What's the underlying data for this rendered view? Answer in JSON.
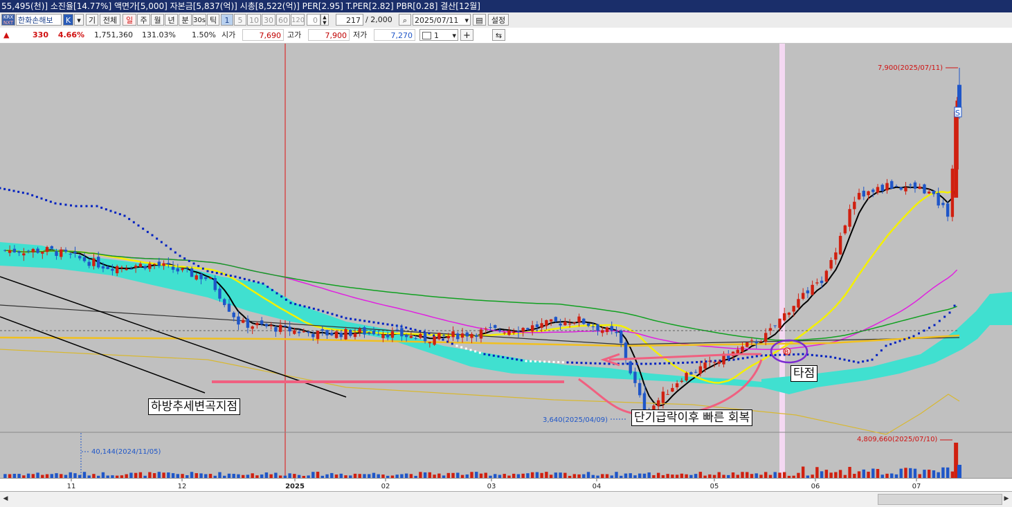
{
  "titlebar": {
    "text": "55,495(천)] 소진율[14.77%] 액면가[5,000] 자본금[5,837(억)] 시총[8,522(억)] PER[2.95] T.PER[2.82] PBR[0.28] 결산[12월]"
  },
  "toolbar": {
    "krx": "KRX",
    "nxt": "NXT",
    "stock_name": "한화손해보",
    "k_button": "K",
    "gi_button": "기",
    "all_button": "전체",
    "periods": [
      "일",
      "주",
      "월",
      "년",
      "분",
      "30s",
      "틱"
    ],
    "intervals": [
      "1",
      "5",
      "10",
      "30",
      "60",
      "120"
    ],
    "spin_value": "0",
    "count_value": "217",
    "count_max": "/ 2,000",
    "date_value": "2025/07/11",
    "settings_button": "설정"
  },
  "quote": {
    "change": "330",
    "change_pct": "4.66%",
    "volume": "1,751,360",
    "volume_ratio": "131.03%",
    "turnover": "1.50%",
    "open_label": "시가",
    "open": "7,690",
    "high_label": "고가",
    "high": "7,900",
    "low_label": "저가",
    "low": "7,270",
    "line_select": "1"
  },
  "chart_labels": {
    "high_mark": "7,900(2025/07/11)",
    "low_mark": "3,640(2025/04/09)",
    "volume_max": "4,809,660(2025/07/10)",
    "volume_min": "40,144(2024/11/05)",
    "sell_signal": "S",
    "buy_signal": "B"
  },
  "annotations": {
    "downtrend_turn": "하방추세변곡지점",
    "quick_recovery": "단기급락이후 빠른 회복",
    "hit_point": "타점"
  },
  "chart_data": {
    "type": "candlestick",
    "x_axis_labels": [
      "11",
      "12",
      "2025",
      "02",
      "03",
      "04",
      "05",
      "06",
      "07"
    ],
    "close_points": [
      [
        "2024/10/15",
        5650
      ],
      [
        "2024/11/01",
        5450
      ],
      [
        "2024/11/15",
        5480
      ],
      [
        "2024/12/01",
        5300
      ],
      [
        "2024/12/10",
        4750
      ],
      [
        "2024/12/20",
        4700
      ],
      [
        "2025/01/02",
        4620
      ],
      [
        "2025/01/20",
        4650
      ],
      [
        "2025/02/03",
        4560
      ],
      [
        "2025/02/20",
        4650
      ],
      [
        "2025/03/05",
        4700
      ],
      [
        "2025/03/20",
        4800
      ],
      [
        "2025/04/01",
        4600
      ],
      [
        "2025/04/09",
        3640
      ],
      [
        "2025/04/20",
        4100
      ],
      [
        "2025/05/01",
        4300
      ],
      [
        "2025/05/15",
        4600
      ],
      [
        "2025/05/22",
        4950
      ],
      [
        "2025/06/01",
        5300
      ],
      [
        "2025/06/10",
        6300
      ],
      [
        "2025/06/20",
        6450
      ],
      [
        "2025/07/01",
        6400
      ],
      [
        "2025/07/08",
        6100
      ],
      [
        "2025/07/10",
        7360
      ],
      [
        "2025/07/11",
        7690
      ]
    ],
    "price_high": 7900,
    "price_low": 3640,
    "volume_high": 4809660,
    "volume_low": 40144,
    "colors": {
      "up": "#d02010",
      "down": "#1f56c8",
      "cloud": "#40e0d0",
      "ma5": "#000000",
      "ma20": "#f4f000",
      "ma60": "#e020e0",
      "ma120": "#10a020",
      "dots": "#0020c0"
    }
  }
}
